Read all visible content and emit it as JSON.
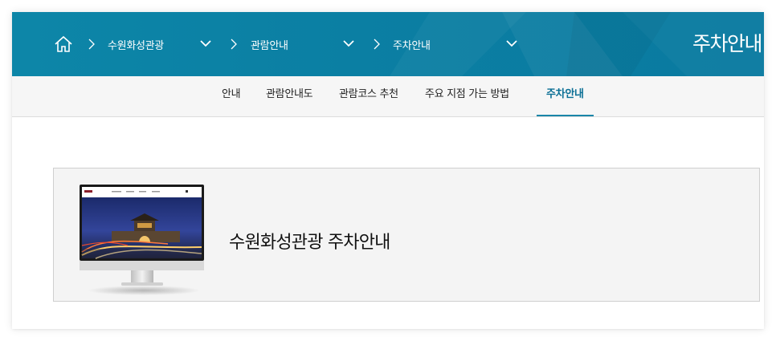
{
  "breadcrumb": {
    "home_icon": "home-icon",
    "items": [
      {
        "label": "수원화성관광"
      },
      {
        "label": "관람안내"
      },
      {
        "label": "주차안내"
      }
    ]
  },
  "header": {
    "title": "주차안내"
  },
  "subnav": {
    "tabs": [
      {
        "label": "안내",
        "active": false
      },
      {
        "label": "관람안내도",
        "active": false
      },
      {
        "label": "관람코스 추천",
        "active": false
      },
      {
        "label": "주요 지점 가는 방법",
        "active": false
      },
      {
        "label": "주차안내",
        "active": true
      }
    ]
  },
  "banner": {
    "title": "수원화성관광 주차안내",
    "image": "monitor-screenshot-image"
  },
  "colors": {
    "header_bg": "#0b7fa3",
    "active_tab": "#0b6f95",
    "subnav_bg": "#f6f6f6",
    "banner_bg": "#f4f4f4"
  }
}
